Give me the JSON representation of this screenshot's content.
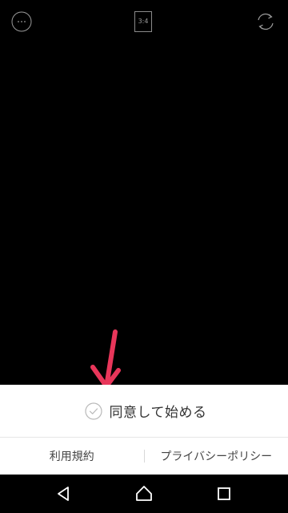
{
  "camera": {
    "aspect_ratio_label": "3:4",
    "more_icon": "more-horizontal-icon",
    "flip_icon": "camera-flip-icon"
  },
  "annotation": {
    "arrow_color": "#e8365a"
  },
  "agreement": {
    "label": "同意して始める",
    "check_icon": "check-circle-icon",
    "checked": false
  },
  "links": {
    "terms_label": "利用規約",
    "privacy_label": "プライバシーポリシー"
  },
  "navbar": {
    "back_icon": "back-triangle-icon",
    "home_icon": "home-icon",
    "recent_icon": "recent-apps-icon"
  },
  "colors": {
    "background": "#000000",
    "sheet": "#ffffff",
    "accent": "#e8365a"
  }
}
